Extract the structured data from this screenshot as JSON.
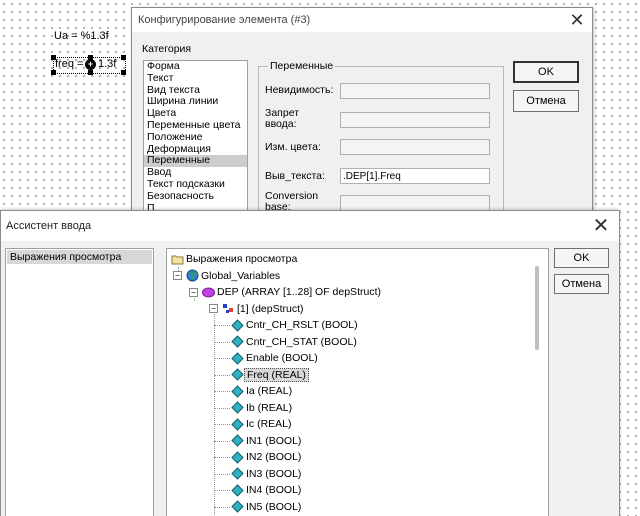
{
  "canvas": {
    "label1": "Ua = %1.3f",
    "label2_left": "freq =",
    "label2_right": "1.3f"
  },
  "config_dialog": {
    "title": "Конфигурирование элемента (#3)",
    "category_label": "Категория",
    "categories": [
      "Форма",
      "Текст",
      "Вид текста",
      "Ширина линии",
      "Цвета",
      "Переменные цвета",
      "Положение",
      "Деформация",
      "Переменные",
      "Ввод",
      "Текст подсказки",
      "Безопасность",
      "П..."
    ],
    "selected_category": "Переменные",
    "group_title": "Переменные",
    "fields": [
      {
        "label": "Невидимость:",
        "value": ""
      },
      {
        "label": "Запрет ввода:",
        "value": ""
      },
      {
        "label": "Изм. цвета:",
        "value": ""
      },
      {
        "label": "Выв_текста:",
        "value": ".DEP[1].Freq"
      },
      {
        "label": "Conversion base:",
        "value": ""
      }
    ],
    "ok_label": "OK",
    "cancel_label": "Отмена"
  },
  "input_assistant": {
    "title": "Ассистент ввода",
    "left_items": [
      "Выражения просмотра"
    ],
    "root_label": "Выражения просмотра",
    "tree": [
      {
        "label": "Global_Variables",
        "icon": "globe-icon"
      },
      {
        "label": "DEP (ARRAY [1..28] OF depStruct)",
        "icon": "struct-icon"
      },
      {
        "label": "[1] (depStruct)",
        "icon": "struct-small-icon"
      },
      {
        "label": "Cntr_CH_RSLT (BOOL)",
        "icon": "var-icon"
      },
      {
        "label": "Cntr_CH_STAT (BOOL)",
        "icon": "var-icon"
      },
      {
        "label": "Enable (BOOL)",
        "icon": "var-icon"
      },
      {
        "label": "Freq (REAL)",
        "icon": "var-icon"
      },
      {
        "label": "Ia (REAL)",
        "icon": "var-icon"
      },
      {
        "label": "Ib (REAL)",
        "icon": "var-icon"
      },
      {
        "label": "Ic (REAL)",
        "icon": "var-icon"
      },
      {
        "label": "IN1 (BOOL)",
        "icon": "var-icon"
      },
      {
        "label": "IN2 (BOOL)",
        "icon": "var-icon"
      },
      {
        "label": "IN3 (BOOL)",
        "icon": "var-icon"
      },
      {
        "label": "IN4 (BOOL)",
        "icon": "var-icon"
      },
      {
        "label": "IN5 (BOOL)",
        "icon": "var-icon"
      }
    ],
    "selected_item": "Freq (REAL)",
    "ok_label": "OK",
    "cancel_label": "Отмена"
  }
}
